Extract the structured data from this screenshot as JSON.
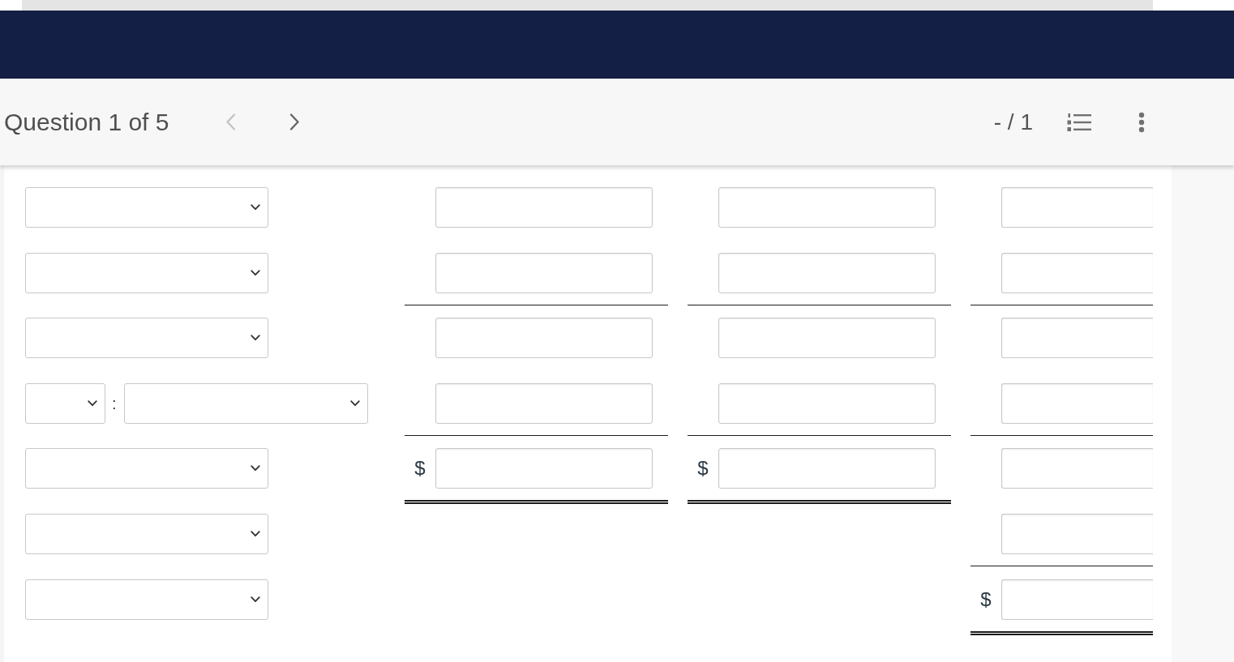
{
  "toolbar": {
    "question_label": "Question 1 of 5",
    "previous_button": {
      "disabled": true
    },
    "next_button": {
      "disabled": false
    },
    "score": "- / 1",
    "actions": [
      {
        "kind": "question-list"
      },
      {
        "kind": "more"
      }
    ]
  },
  "worksheet": {
    "rows": [
      {
        "label": {
          "kind": "dropdown"
        },
        "cells": [
          {
            "kind": "input"
          },
          {
            "kind": "input"
          },
          {
            "kind": "input"
          }
        ]
      },
      {
        "label": {
          "kind": "dropdown"
        },
        "cells": [
          {
            "kind": "input",
            "underline": {
              "kind": "single"
            }
          },
          {
            "kind": "input",
            "underline": {
              "kind": "single"
            }
          },
          {
            "kind": "input",
            "underline": {
              "kind": "single"
            }
          }
        ]
      },
      {
        "label": {
          "kind": "dropdown"
        },
        "cells": [
          {
            "kind": "input"
          },
          {
            "kind": "input"
          },
          {
            "kind": "input"
          }
        ]
      },
      {
        "label": {
          "kind": "dropdown-pair",
          "separator": ":"
        },
        "cells": [
          {
            "kind": "input",
            "underline": {
              "kind": "single"
            }
          },
          {
            "kind": "input",
            "underline": {
              "kind": "single"
            }
          },
          {
            "kind": "input",
            "underline": {
              "kind": "single"
            }
          }
        ]
      },
      {
        "label": {
          "kind": "dropdown"
        },
        "cells": [
          {
            "kind": "input",
            "prefix": "$",
            "underline": {
              "kind": "double"
            }
          },
          {
            "kind": "input",
            "prefix": "$",
            "underline": {
              "kind": "double"
            }
          },
          {
            "kind": "input"
          }
        ]
      },
      {
        "label": {
          "kind": "dropdown"
        },
        "cells": [
          {
            "kind": "blank"
          },
          {
            "kind": "blank"
          },
          {
            "kind": "input",
            "underline": {
              "kind": "single"
            }
          }
        ]
      },
      {
        "label": {
          "kind": "dropdown"
        },
        "cells": [
          {
            "kind": "blank"
          },
          {
            "kind": "blank"
          },
          {
            "kind": "input",
            "prefix": "$",
            "underline": {
              "kind": "double"
            }
          }
        ]
      }
    ]
  }
}
